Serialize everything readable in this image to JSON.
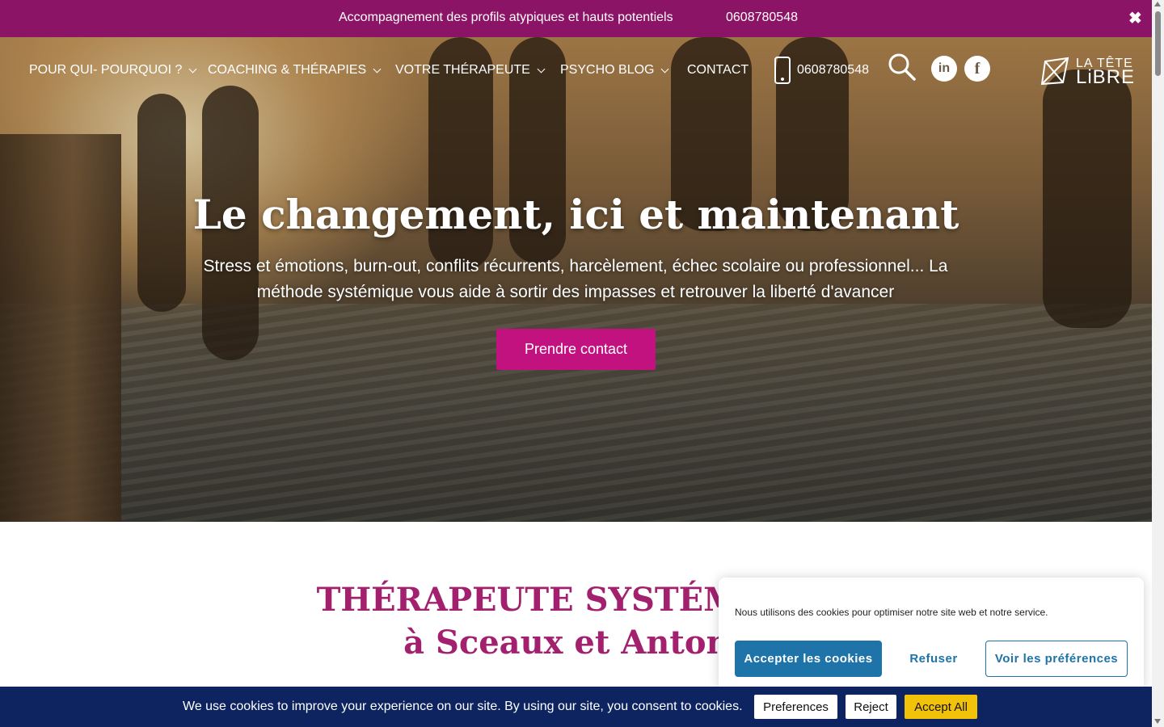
{
  "topbar": {
    "message": "Accompagnement des profils atypiques et hauts potentiels",
    "phone": "0608780548",
    "close_glyph": "✖"
  },
  "nav": {
    "items": [
      {
        "label": "POUR QUI- POURQUOI ?",
        "has_dropdown": true
      },
      {
        "label": "COACHING & THÉRAPIES",
        "has_dropdown": true
      },
      {
        "label": "VOTRE THÉRAPEUTE",
        "has_dropdown": true
      },
      {
        "label": "PSYCHO BLOG",
        "has_dropdown": true
      },
      {
        "label": "CONTACT",
        "has_dropdown": false
      }
    ],
    "phone": "0608780548",
    "icons": [
      "phone-icon",
      "search-icon",
      "linkedin-icon",
      "facebook-icon"
    ],
    "linkedin_glyph": "in",
    "facebook_glyph": "f",
    "logo": {
      "line1": "LA TÊTE",
      "line2": "LiBRE"
    }
  },
  "hero": {
    "title": "Le changement, ici et maintenant",
    "subtitle": "Stress et émotions, burn-out, conflits récurrents, harcèlement, échec scolaire ou professionnel... La méthode systémique vous aide à sortir des impasses et retrouver la liberté d'avancer",
    "cta": "Prendre contact"
  },
  "section": {
    "heading_line1": "THÉRAPEUTE SYSTÉMIQUE",
    "heading_line2": "à Sceaux et Antony"
  },
  "cookie_popup": {
    "text": "Nous utilisons des cookies pour optimiser notre site web et notre service.",
    "accept": "Accepter les cookies",
    "refuse": "Refuser",
    "preferences": "Voir les préférences"
  },
  "cookie_bar": {
    "text": "We use cookies to improve your experience on our site. By using our site, you consent to cookies.",
    "preferences": "Preferences",
    "reject": "Reject",
    "accept": "Accept All"
  },
  "colors": {
    "brand_magenta": "#8c1466",
    "cta": "#c2127f",
    "heading": "#a3206f",
    "popup_blue": "#1e73a8",
    "cookiebar_bg": "#0d2461",
    "accept_yellow": "#f2c20a"
  }
}
